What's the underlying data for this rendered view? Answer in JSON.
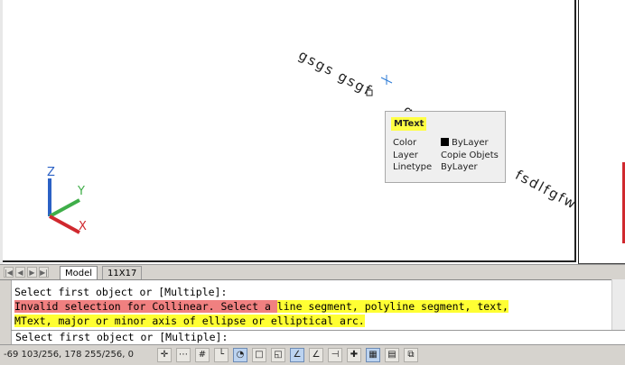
{
  "drawing": {
    "text_fragments": [
      "gsgs gsgf",
      "gs",
      "fsdlfgfw"
    ],
    "ucs_labels": {
      "z": "Z",
      "y": "Y",
      "x": "X"
    }
  },
  "tooltip": {
    "title": "MText",
    "rows": [
      {
        "label": "Color",
        "value": "ByLayer"
      },
      {
        "label": "Layer",
        "value": "Copie Objets"
      },
      {
        "label": "Linetype",
        "value": "ByLayer"
      }
    ]
  },
  "tabs": {
    "model": "Model",
    "layout": "11X17"
  },
  "command_line": {
    "line1": "Select first object or [Multiple]:",
    "line2_red": "Invalid selection for Collinear. Select a ",
    "line2_yellow": "line segment, polyline segment, text,",
    "line3_yellow": "MText, major or minor axis of ellipse or elliptical arc.",
    "prompt": "Select first object or [Multiple]:"
  },
  "status": {
    "coordinates": "-69 103/256, 178 255/256, 0"
  },
  "colors": {
    "tooltip_title_bg": "#ffff44",
    "error_highlight": "#f08080",
    "text_highlight": "#ffff33",
    "ucs_z": "#2b61c5",
    "ucs_y": "#3fae49",
    "ucs_x": "#d0282e"
  }
}
